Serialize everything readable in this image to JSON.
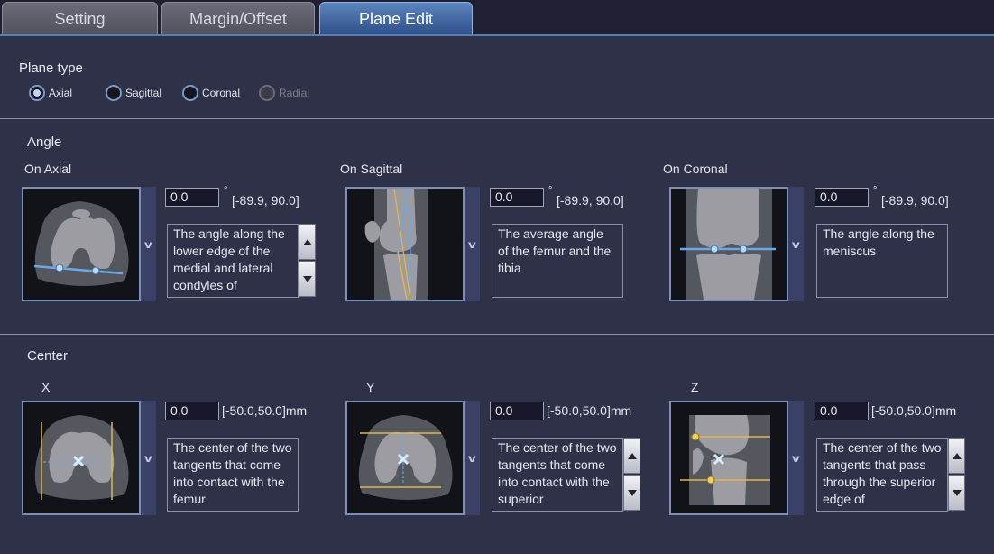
{
  "tabs": [
    {
      "label": "Setting",
      "active": false
    },
    {
      "label": "Margin/Offset",
      "active": false
    },
    {
      "label": "Plane Edit",
      "active": true
    }
  ],
  "plane_type": {
    "title": "Plane type",
    "options": [
      {
        "label": "Axial",
        "selected": true,
        "enabled": true
      },
      {
        "label": "Sagittal",
        "selected": false,
        "enabled": true
      },
      {
        "label": "Coronal",
        "selected": false,
        "enabled": true
      },
      {
        "label": "Radial",
        "selected": false,
        "enabled": false
      }
    ]
  },
  "angle": {
    "title": "Angle",
    "degree_symbol": "°",
    "panels": [
      {
        "title": "On Axial",
        "value": "0.0",
        "range": "[-89.9, 90.0]",
        "description": "The angle along the lower edge of the medial and lateral condyles of"
      },
      {
        "title": "On Sagittal",
        "value": "0.0",
        "range": "[-89.9, 90.0]",
        "description": "The average angle of the femur and the tibia"
      },
      {
        "title": "On Coronal",
        "value": "0.0",
        "range": "[-89.9, 90.0]",
        "description": "The angle along the meniscus"
      }
    ]
  },
  "center": {
    "title": "Center",
    "panels": [
      {
        "title": "X",
        "value": "0.0",
        "range": "[-50.0,50.0]mm",
        "description": "The center of the two tangents that come into contact with the femur"
      },
      {
        "title": "Y",
        "value": "0.0",
        "range": "[-50.0,50.0]mm",
        "description": "The center of the two tangents that come into contact with the superior"
      },
      {
        "title": "Z",
        "value": "0.0",
        "range": "[-50.0,50.0]mm",
        "description": "The center of the two tangents that pass through the superior edge of"
      }
    ]
  },
  "expand_glyph": "v",
  "colors": {
    "accent_line": "#6aa8e8",
    "guide_line": "#e0b84a",
    "bone": "#9a9aa0",
    "tissue": "#555760"
  }
}
